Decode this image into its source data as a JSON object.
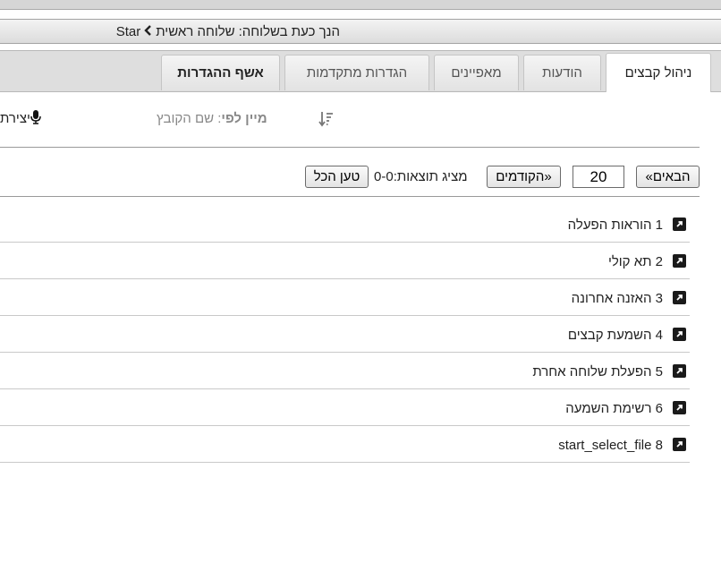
{
  "breadcrumb": {
    "prefix": "הנך כעת בשלוחה:",
    "current": "שלוחה ראשית",
    "root": "Star"
  },
  "tabs": [
    {
      "label": "ניהול קבצים",
      "active": true
    },
    {
      "label": "הודעות"
    },
    {
      "label": "מאפיינים"
    },
    {
      "label": "הגדרות מתקדמות"
    },
    {
      "label": "אשף ההגדרות"
    }
  ],
  "sort": {
    "label": "מיין לפי",
    "value": ": שם הקובץ"
  },
  "record": {
    "label": "יצירת"
  },
  "pager": {
    "next_label": "«הבאים",
    "count": "20",
    "prev_label": "הקודמים»",
    "showing_label": "מציג תוצאות:",
    "range": "0-0",
    "load_all_label": "טען הכל"
  },
  "files": [
    {
      "number": "1",
      "name": "הוראות הפעלה"
    },
    {
      "number": "2",
      "name": "תא קולי"
    },
    {
      "number": "3",
      "name": "האזנה אחרונה"
    },
    {
      "number": "4",
      "name": "השמעת קבצים"
    },
    {
      "number": "5",
      "name": "הפעלת שלוחה אחרת"
    },
    {
      "number": "6",
      "name": "רשימת השמעה"
    },
    {
      "number": "8",
      "name": "start_select_file"
    }
  ]
}
